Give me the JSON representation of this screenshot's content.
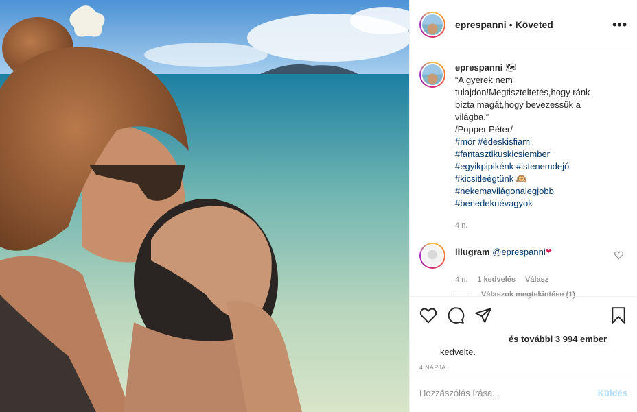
{
  "post": {
    "username": "eprespanni",
    "separator": "•",
    "follow_status": "Követed",
    "more_icon": "•••",
    "caption": {
      "username": "eprespanni",
      "emoji": "🗺",
      "text_lines": [
        "“A gyerek nem",
        "tulajdon!Megtiszteltetés,hogy ránk",
        "bízta magát,hogy bevezessük a",
        "világba.”",
        "/Popper Péter/"
      ],
      "hashtag_lines": [
        "#mór #édeskisfiam",
        "#fantasztikuskicsiember",
        "#egyikpipikénk #istenemdejó",
        "#kicsitleégtünk 🙉",
        "#nekemavilágonalegjobb",
        "#benedeknévagyok"
      ],
      "time": "4 n."
    },
    "comment": {
      "username": "lilugram",
      "mention": "@eprespanni",
      "emoji": "❤",
      "time": "4 n.",
      "likes": "1 kedvelés",
      "reply": "Válasz",
      "view_replies": "Válaszok megtekintése (1)"
    },
    "likes_line1": "és további 3 994 ember",
    "likes_line2": "kedvelte.",
    "date": "4 NAPJA",
    "add_comment_placeholder": "Hozzászólás írása...",
    "send_label": "Küldés"
  },
  "colors": {
    "link": "#00376b",
    "muted": "#8e8e8e",
    "send": "#b2dffc"
  },
  "icons": [
    "heart-icon",
    "comment-icon",
    "share-icon",
    "bookmark-icon",
    "more-options-icon"
  ]
}
